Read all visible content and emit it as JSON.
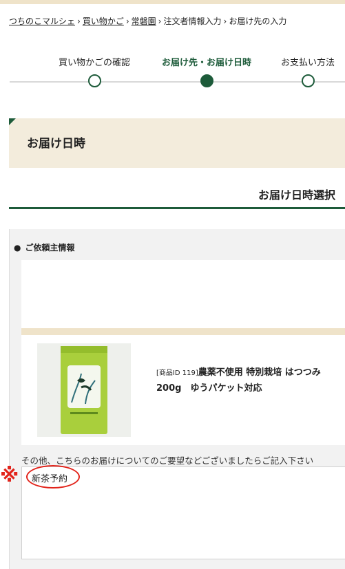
{
  "breadcrumb": {
    "items": [
      "つちのこマルシェ",
      "買い物かご",
      "常磐園",
      "注文者情報入力",
      "お届け先の入力"
    ],
    "separator": "›"
  },
  "steps": [
    {
      "label": "買い物かごの確認",
      "active": false
    },
    {
      "label": "お届け先・お届け日時",
      "active": true
    },
    {
      "label": "お支払い方法",
      "active": false
    }
  ],
  "section": {
    "title": "お届け日時",
    "subtitle": "お届け日時選択"
  },
  "requester": {
    "bullet": "●",
    "title": "ご依頼主情報"
  },
  "product": {
    "id_label": "[商品ID 119]",
    "name_line1": "農薬不使用 特別栽培 はつつみ",
    "name_line2": "200g　ゆうパケット対応"
  },
  "notes": {
    "label": "その他、こちらのお届けについてのご要望などございましたらご記入下さい",
    "value": "新茶予約"
  },
  "annotation": {
    "mark": "※"
  },
  "colors": {
    "accent": "#1d5b3a",
    "beige": "#f3ecdc",
    "annotation": "#e2231a"
  }
}
